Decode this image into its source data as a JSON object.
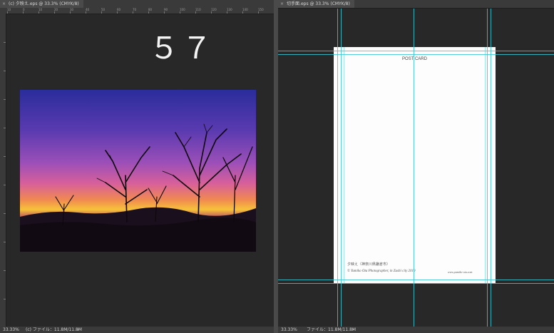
{
  "left_window": {
    "tab_title": "(c) 夕映え.eps @ 33.3% (CMYK/8)",
    "ruler_ticks": [
      "10",
      "0",
      "10",
      "20",
      "30",
      "40",
      "50",
      "60",
      "70",
      "80",
      "90",
      "100",
      "110",
      "120",
      "130",
      "140",
      "150"
    ],
    "overlay_number": "５７",
    "status": {
      "zoom": "33.33%",
      "file_label": "(c) ファイル：11.8M/11.8M"
    }
  },
  "right_window": {
    "tab_title": "切手面.eps @ 33.3% (CMYK/8)",
    "postcard": {
      "title": "POST CARD",
      "caption": "夕映え（神奈川県鎌倉市）",
      "credit": "© Yumiko Ota Photographer, in Zushi city 2019",
      "url": "www.yumiko-ota.com"
    },
    "status": {
      "zoom": "33.33%",
      "file_label": "ファイル：11.8M/11.8M"
    }
  },
  "colors": {
    "guide": "#36c8d6",
    "canvas": "#282828",
    "chrome": "#3a3a3a"
  }
}
